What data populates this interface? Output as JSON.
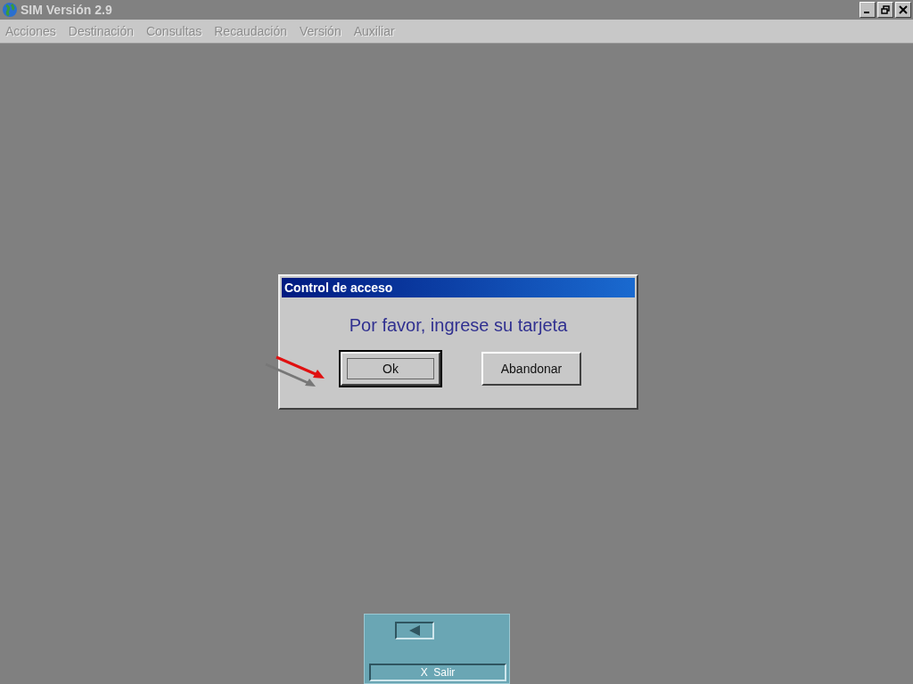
{
  "window": {
    "title": "SIM Versión 2.9"
  },
  "menu": [
    {
      "label": "Acciones",
      "disabled": true
    },
    {
      "label": "Destinación",
      "disabled": true
    },
    {
      "label": "Consultas",
      "disabled": true
    },
    {
      "label": "Recaudación",
      "disabled": true
    },
    {
      "label": "Versión",
      "disabled": true
    },
    {
      "label": "Auxiliar",
      "disabled": true
    }
  ],
  "dialog": {
    "title": "Control de acceso",
    "message": "Por favor, ingrese su tarjeta",
    "buttons": [
      {
        "label": "Ok",
        "default": true
      },
      {
        "label": "Abandonar",
        "default": false
      }
    ]
  },
  "bottom_panel": {
    "exit_button": "X  Salir"
  }
}
